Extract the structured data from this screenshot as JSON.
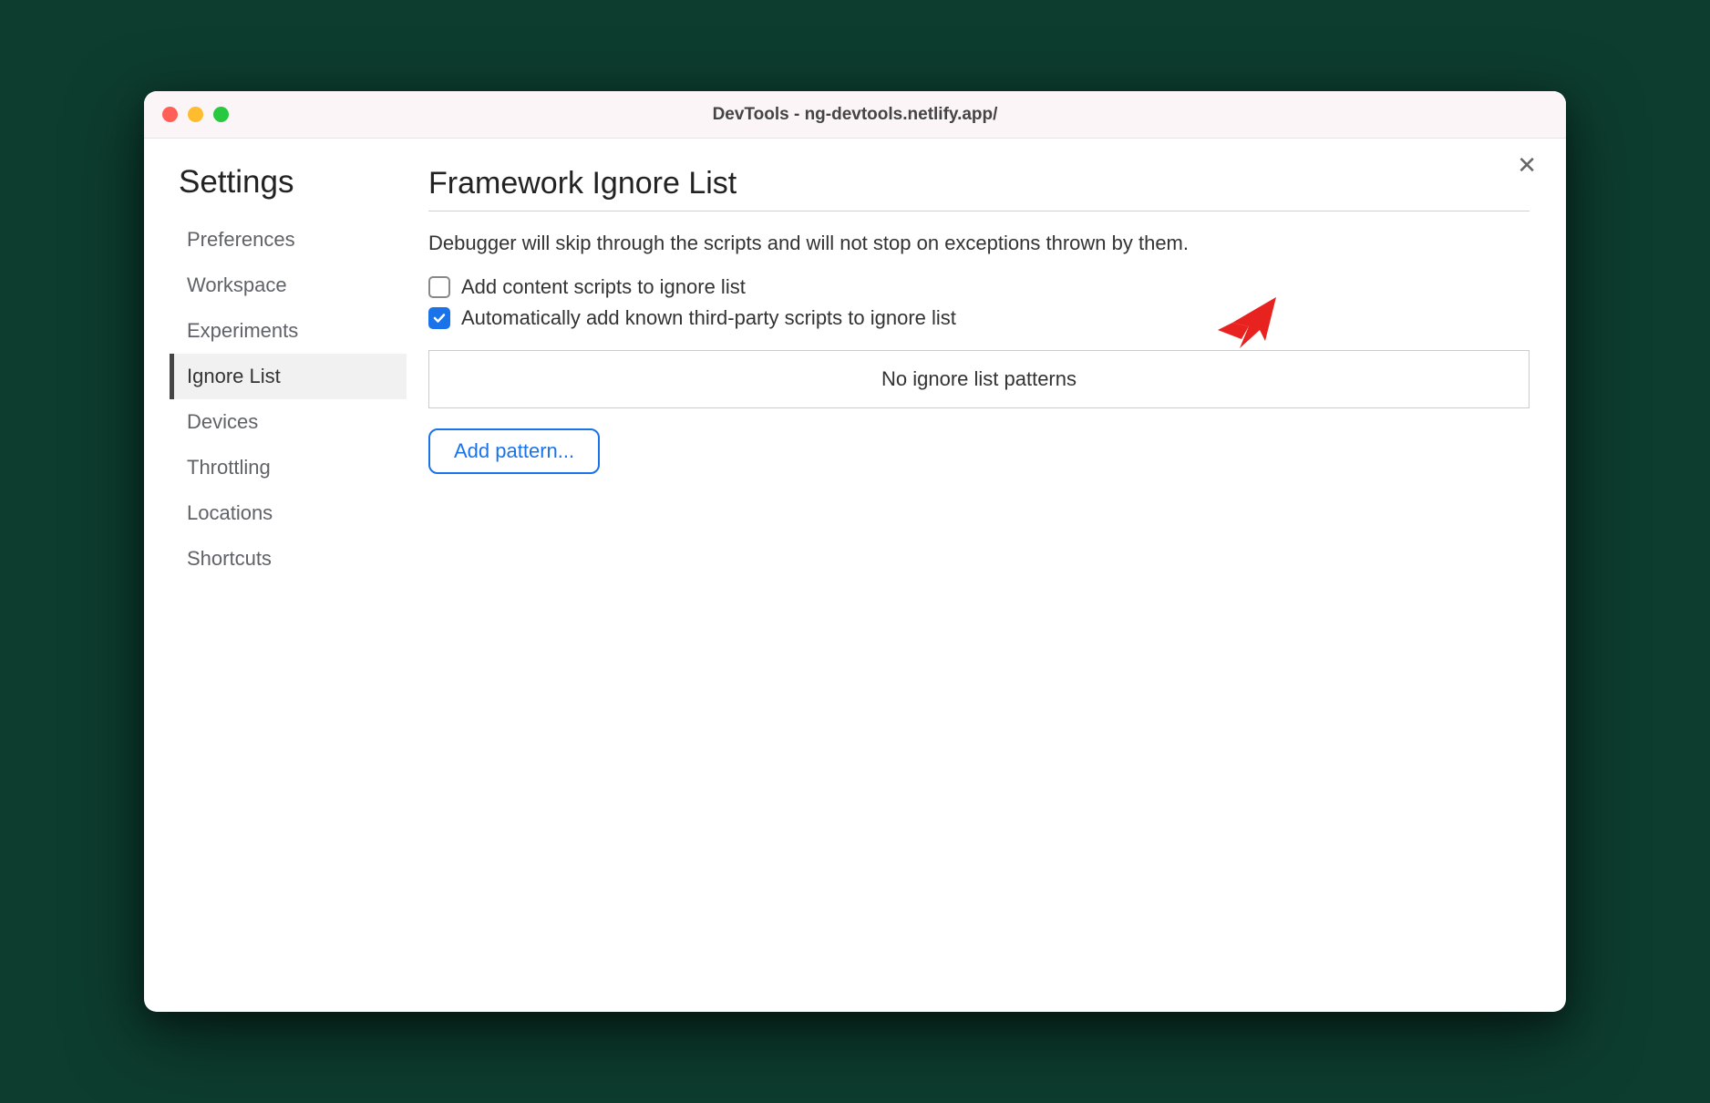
{
  "window": {
    "title": "DevTools - ng-devtools.netlify.app/"
  },
  "sidebar": {
    "title": "Settings",
    "items": [
      {
        "label": "Preferences",
        "selected": false
      },
      {
        "label": "Workspace",
        "selected": false
      },
      {
        "label": "Experiments",
        "selected": false
      },
      {
        "label": "Ignore List",
        "selected": true
      },
      {
        "label": "Devices",
        "selected": false
      },
      {
        "label": "Throttling",
        "selected": false
      },
      {
        "label": "Locations",
        "selected": false
      },
      {
        "label": "Shortcuts",
        "selected": false
      }
    ]
  },
  "main": {
    "title": "Framework Ignore List",
    "description": "Debugger will skip through the scripts and will not stop on exceptions thrown by them.",
    "checkboxes": [
      {
        "label": "Add content scripts to ignore list",
        "checked": false
      },
      {
        "label": "Automatically add known third-party scripts to ignore list",
        "checked": true
      }
    ],
    "pattern_box": "No ignore list patterns",
    "add_button": "Add pattern..."
  },
  "annotation": {
    "color": "#e8221f"
  }
}
